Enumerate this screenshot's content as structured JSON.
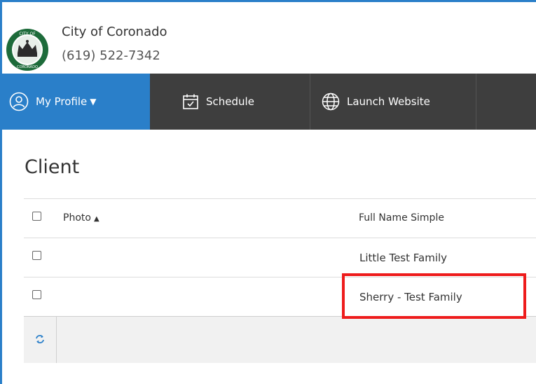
{
  "header": {
    "org_name": "City of Coronado",
    "phone": "(619) 522-7342",
    "logo_text": "CITY OF CORONADO"
  },
  "nav": {
    "profile_label": "My Profile",
    "schedule_label": "Schedule",
    "launch_label": "Launch Website"
  },
  "page": {
    "title": "Client"
  },
  "table": {
    "columns": [
      "Photo",
      "Full Name Simple"
    ],
    "sort": "ascending",
    "rows": [
      {
        "full_name": "Little Test Family"
      },
      {
        "full_name": "Sherry - Test Family"
      }
    ]
  },
  "colors": {
    "accent": "#2a7fc9",
    "navbar": "#3e3e3e",
    "highlight": "#ee1c1c",
    "footer": "#f1f1f1"
  },
  "icons": [
    "city-seal-logo",
    "user-circle-icon",
    "calendar-check-icon",
    "globe-icon",
    "refresh-icon",
    "sort-ascending-icon"
  ]
}
